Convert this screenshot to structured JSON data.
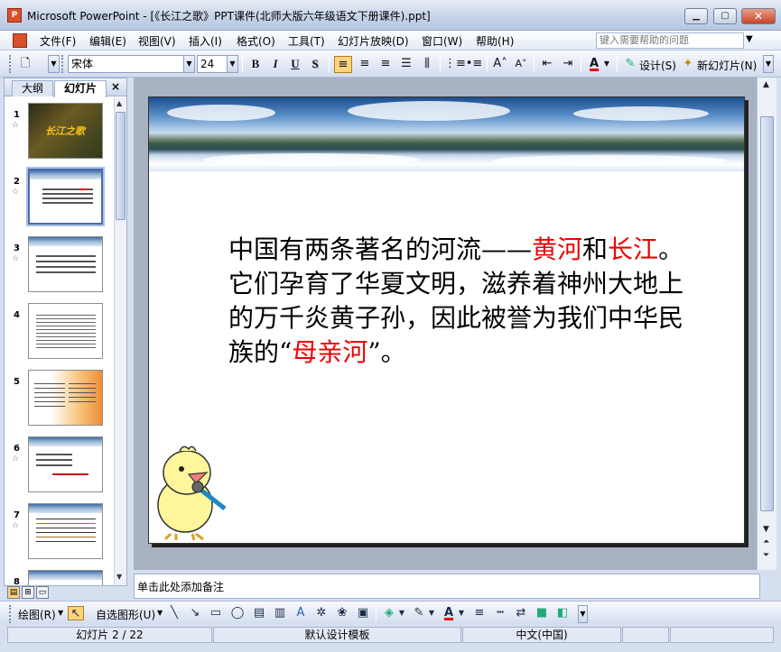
{
  "window": {
    "title": "Microsoft PowerPoint - [《长江之歌》PPT课件(北师大版六年级语文下册课件).ppt]",
    "app_icon": "P"
  },
  "menu": {
    "items": [
      "文件(F)",
      "编辑(E)",
      "视图(V)",
      "插入(I)",
      "格式(O)",
      "工具(T)",
      "幻灯片放映(D)",
      "窗口(W)",
      "帮助(H)"
    ],
    "help_placeholder": "键入需要帮助的问题"
  },
  "toolbar": {
    "font_name": "宋体",
    "font_size": "24",
    "bold": "B",
    "italic": "I",
    "underline": "U",
    "shadow": "S",
    "design_label": "设计(S)",
    "new_slide_label": "新幻灯片(N)",
    "font_color_letter": "A"
  },
  "pane": {
    "tab_outline": "大纲",
    "tab_slides": "幻灯片",
    "close": "×",
    "thumbnails": [
      {
        "num": "1",
        "star": "☆"
      },
      {
        "num": "2",
        "star": "☆"
      },
      {
        "num": "3",
        "star": "☆"
      },
      {
        "num": "4",
        "star": ""
      },
      {
        "num": "5",
        "star": ""
      },
      {
        "num": "6",
        "star": "☆"
      },
      {
        "num": "7",
        "star": "☆"
      },
      {
        "num": "8",
        "star": ""
      }
    ],
    "thumb1_caption": "长江之歌"
  },
  "slide": {
    "text_part1": "中国有两条著名的河流——",
    "text_red1": "黄河",
    "text_part2": "和",
    "text_red2": "长江",
    "text_part3": "。它们孕育了华夏文明，滋养着神州大地上的万千炎黄子孙，因此被誉为我们中华民族的“",
    "text_red3": "母亲河",
    "text_part4": "”。"
  },
  "notes": {
    "placeholder": "单击此处添加备注"
  },
  "drawbar": {
    "draw_label": "绘图(R)",
    "autoshapes_label": "自选图形(U)",
    "font_color_letter": "A"
  },
  "status": {
    "slide_info": "幻灯片 2 / 22",
    "template": "默认设计模板",
    "language": "中文(中国)"
  },
  "colors": {
    "accent_red": "#e00000",
    "selection": "#ffd47e"
  }
}
